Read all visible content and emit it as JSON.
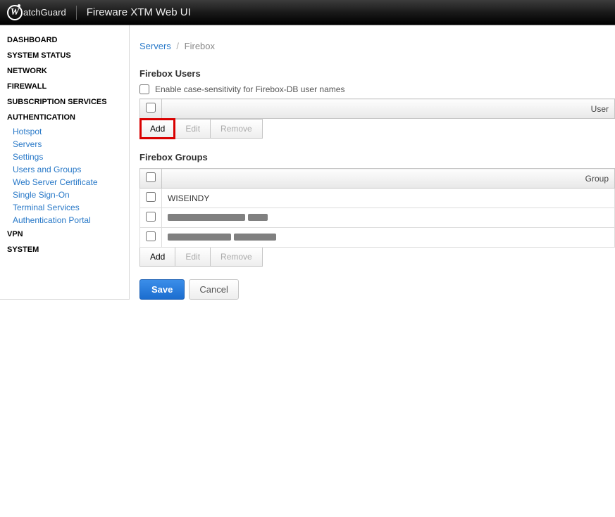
{
  "header": {
    "brand": "atchGuard",
    "logo_letter": "W",
    "title": "Fireware XTM Web UI"
  },
  "sidebar": {
    "sections": [
      {
        "label": "DASHBOARD"
      },
      {
        "label": "SYSTEM STATUS"
      },
      {
        "label": "NETWORK"
      },
      {
        "label": "FIREWALL"
      },
      {
        "label": "SUBSCRIPTION SERVICES"
      },
      {
        "label": "AUTHENTICATION",
        "items": [
          {
            "label": "Hotspot"
          },
          {
            "label": "Servers"
          },
          {
            "label": "Settings"
          },
          {
            "label": "Users and Groups"
          },
          {
            "label": "Web Server Certificate"
          },
          {
            "label": "Single Sign-On"
          },
          {
            "label": "Terminal Services"
          },
          {
            "label": "Authentication Portal"
          }
        ]
      },
      {
        "label": "VPN"
      },
      {
        "label": "SYSTEM"
      }
    ]
  },
  "breadcrumb": {
    "parent": "Servers",
    "separator": "/",
    "current": "Firebox"
  },
  "users": {
    "title": "Firebox Users",
    "case_sensitivity_label": "Enable case-sensitivity for Firebox-DB user names",
    "column_header": "User",
    "buttons": {
      "add": "Add",
      "edit": "Edit",
      "remove": "Remove"
    }
  },
  "groups": {
    "title": "Firebox Groups",
    "column_header": "Group",
    "rows": [
      {
        "name": "WISEINDY",
        "redacted": false
      },
      {
        "name": "",
        "redacted": true,
        "widths": [
          110,
          28
        ]
      },
      {
        "name": "",
        "redacted": true,
        "widths": [
          90,
          60
        ]
      }
    ],
    "buttons": {
      "add": "Add",
      "edit": "Edit",
      "remove": "Remove"
    }
  },
  "actions": {
    "save": "Save",
    "cancel": "Cancel"
  }
}
